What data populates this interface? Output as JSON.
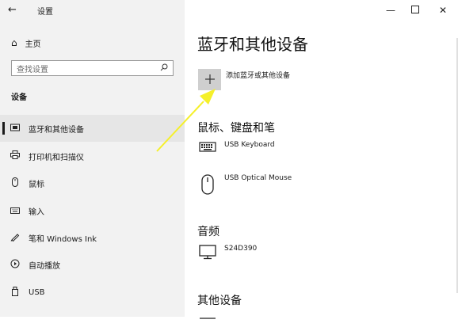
{
  "window": {
    "title": "设置",
    "back_glyph": "←",
    "minimize_glyph": "—",
    "maximize_glyph": "☐",
    "close_glyph": "✕"
  },
  "sidebar": {
    "home_label": "主页",
    "search_placeholder": "查找设置",
    "section_label": "设备",
    "items": [
      {
        "label": "蓝牙和其他设备",
        "icon": "bluetooth-icon",
        "glyph": "▭",
        "selected": true
      },
      {
        "label": "打印机和扫描仪",
        "icon": "printer-icon",
        "glyph": "⎙",
        "selected": false
      },
      {
        "label": "鼠标",
        "icon": "mouse-icon",
        "glyph": "▯",
        "selected": false
      },
      {
        "label": "输入",
        "icon": "keyboard-icon",
        "glyph": "⌨",
        "selected": false
      },
      {
        "label": "笔和 Windows Ink",
        "icon": "pen-icon",
        "glyph": "✎",
        "selected": false
      },
      {
        "label": "自动播放",
        "icon": "autoplay-icon",
        "glyph": "⟳",
        "selected": false
      },
      {
        "label": "USB",
        "icon": "usb-icon",
        "glyph": "▢",
        "selected": false
      }
    ]
  },
  "main": {
    "title": "蓝牙和其他设备",
    "add_device_label": "添加蓝牙或其他设备",
    "groups": {
      "input": {
        "title": "鼠标、键盘和笔",
        "devices": [
          {
            "name": "USB Keyboard",
            "icon": "keyboard-icon"
          },
          {
            "name": "USB Optical Mouse",
            "icon": "mouse-icon"
          }
        ]
      },
      "audio": {
        "title": "音频",
        "devices": [
          {
            "name": "S24D390",
            "icon": "monitor-icon"
          }
        ]
      },
      "other": {
        "title": "其他设备",
        "devices": [
          {
            "name": "",
            "icon": "device-icon"
          }
        ]
      }
    }
  },
  "colors": {
    "sidebar_bg": "#f2f2f2",
    "selected_bg": "#e6e6e6",
    "add_tile_bg": "#cfcfcf",
    "annotation_arrow": "#f5f02a"
  }
}
